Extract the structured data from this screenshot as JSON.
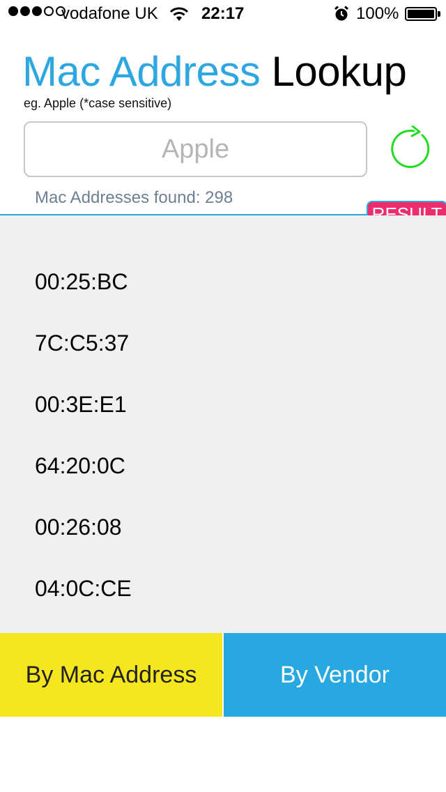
{
  "status": {
    "carrier": "vodafone UK",
    "time": "22:17",
    "battery": "100%",
    "signal_bars": 3,
    "signal_total": 5
  },
  "header": {
    "title_part1": "Mac Address",
    "title_part2": "Lookup",
    "hint": "eg. Apple (*case sensitive)"
  },
  "search": {
    "placeholder": "Apple",
    "value": ""
  },
  "result": {
    "found_label": "Mac Addresses found: 298",
    "badge": "RESULT"
  },
  "items": [
    "00:25:BC",
    "7C:C5:37",
    "00:3E:E1",
    "64:20:0C",
    "00:26:08",
    "04:0C:CE"
  ],
  "tabs": {
    "by_mac": "By Mac Address",
    "by_vendor": "By Vendor"
  },
  "colors": {
    "accent_blue": "#2ea7e0",
    "badge_pink": "#ef2d6c",
    "tab_yellow": "#f6e61f",
    "refresh_green": "#22dd22",
    "list_bg": "#eff0f0"
  }
}
